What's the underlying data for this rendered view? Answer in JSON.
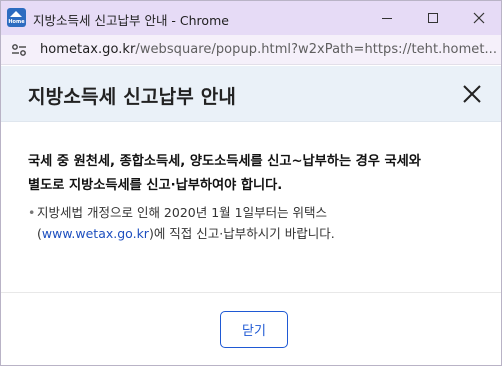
{
  "window": {
    "title": "지방소득세 신고납부 안내 - Chrome",
    "favicon_text": "Home"
  },
  "address": {
    "host": "hometax.go.kr",
    "path": "/websquare/popup.html?w2xPath=https://teht.homet..."
  },
  "popup": {
    "title": "지방소득세 신고납부 안내",
    "main_line1": "국세 중 원천세, 종합소득세, 양도소득세를 신고~납부하는 경우 국세와",
    "main_line2": "별도로 지방소득세를 신고·납부하여야 합니다.",
    "note_bullet": "•",
    "note_line1": "지방세법 개정으로 인해 2020년 1월 1일부터는 위택스",
    "note_paren_open": "(",
    "note_link": "www.wetax.go.kr",
    "note_line2_rest": ")에 직접 신고·납부하시기 바랍니다.",
    "close_button": "닫기"
  },
  "colors": {
    "titlebar_bg": "#e6dbf6",
    "popup_header_bg": "#eaf1f8",
    "accent": "#1f59d4",
    "link": "#1d4fbf"
  }
}
